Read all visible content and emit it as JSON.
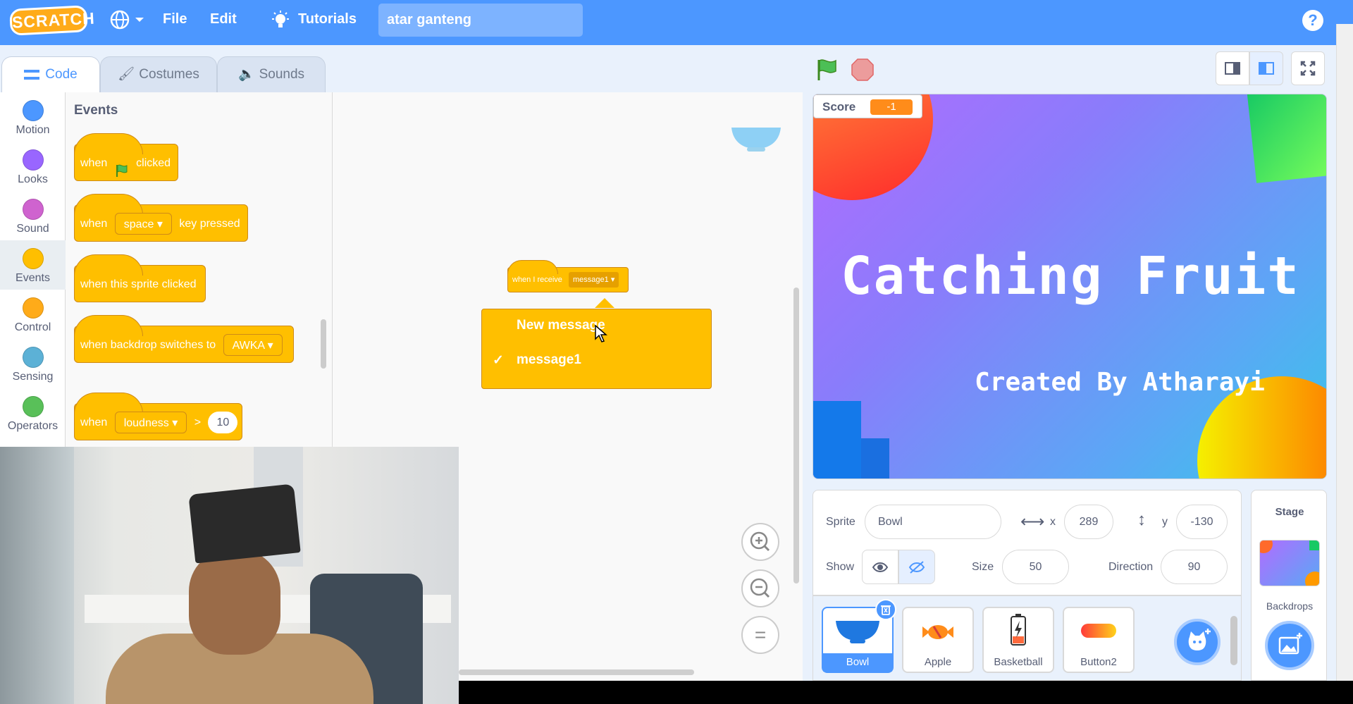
{
  "menubar": {
    "logo": "SCRATCH",
    "file": "File",
    "edit": "Edit",
    "tutorials": "Tutorials",
    "project_title": "atar ganteng",
    "help": "?"
  },
  "tabs": [
    {
      "label": "Code"
    },
    {
      "label": "Costumes"
    },
    {
      "label": "Sounds"
    }
  ],
  "categories": [
    {
      "label": "Motion",
      "color": "#4c97ff"
    },
    {
      "label": "Looks",
      "color": "#9966ff"
    },
    {
      "label": "Sound",
      "color": "#cf63cf"
    },
    {
      "label": "Events",
      "color": "#ffbf00"
    },
    {
      "label": "Control",
      "color": "#ffab19"
    },
    {
      "label": "Sensing",
      "color": "#5cb1d6"
    },
    {
      "label": "Operators",
      "color": "#59c059"
    }
  ],
  "palette": {
    "heading": "Events",
    "blocks": {
      "flag_when": "when",
      "flag_clicked": "clicked",
      "key_when": "when",
      "key_option": "space",
      "key_pressed": "key pressed",
      "sprite_clicked": "when this sprite clicked",
      "backdrop_text": "when backdrop switches to",
      "backdrop_option": "AWKA",
      "loud_when": "when",
      "loud_option": "loudness",
      "loud_op": ">",
      "loud_value": "10"
    }
  },
  "workspace": {
    "script_label": "when I receive",
    "script_option": "message1",
    "dropdown": {
      "new_message": "New message",
      "checkmark": "✓",
      "option": "message1"
    },
    "zoom_reset": "="
  },
  "stage": {
    "monitor_label": "Score",
    "monitor_value": "-1",
    "title": "Catching Fruit",
    "subtitle": "Created By Atharayi"
  },
  "sprite_info": {
    "sprite_label": "Sprite",
    "sprite_name": "Bowl",
    "x_label": "x",
    "x_value": "289",
    "y_label": "y",
    "y_value": "-130",
    "show_label": "Show",
    "size_label": "Size",
    "size_value": "50",
    "direction_label": "Direction",
    "direction_value": "90"
  },
  "sprites": [
    {
      "name": "Bowl"
    },
    {
      "name": "Apple"
    },
    {
      "name": "Basketball"
    },
    {
      "name": "Button2"
    }
  ],
  "stage_panel": {
    "title": "Stage",
    "backdrops_label": "Backdrops"
  },
  "colors": {
    "accent": "#4c97ff",
    "events": "#ffbf00",
    "monitor": "#ff8c1a"
  }
}
